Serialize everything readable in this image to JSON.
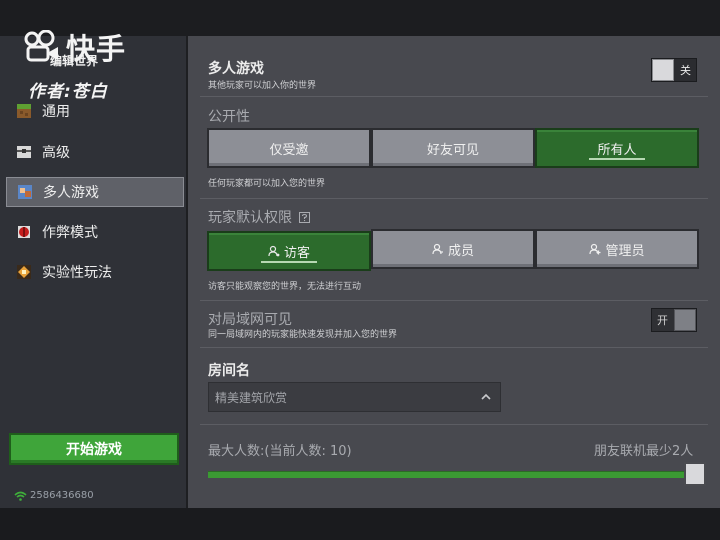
{
  "watermark": {
    "brand": "快手",
    "author": "作者:苍白"
  },
  "sidebar": {
    "title": "编辑世界",
    "items": [
      {
        "label": "通用",
        "icon": "grass-block-icon"
      },
      {
        "label": "高级",
        "icon": "chest-icon"
      },
      {
        "label": "多人游戏",
        "icon": "players-icon",
        "active": true
      },
      {
        "label": "作弊模式",
        "icon": "redstone-icon"
      },
      {
        "label": "实验性玩法",
        "icon": "experiment-icon"
      }
    ],
    "start_button": "开始游戏",
    "server_id": "2586436680"
  },
  "multiplayer": {
    "title": "多人游戏",
    "subtitle": "其他玩家可以加入你的世界",
    "toggle_label": "关",
    "toggle_on": false
  },
  "visibility": {
    "title": "公开性",
    "options": [
      "仅受邀",
      "好友可见",
      "所有人"
    ],
    "selected": "所有人",
    "hint": "任何玩家都可以加入您的世界"
  },
  "permission": {
    "title": "玩家默认权限",
    "options": [
      "访客",
      "成员",
      "管理员"
    ],
    "selected": "访客",
    "hint": "访客只能观察您的世界，无法进行互动"
  },
  "lan": {
    "title": "对局域网可见",
    "subtitle": "同一局域网内的玩家能快速发现并加入您的世界",
    "toggle_label": "开",
    "toggle_on": true
  },
  "room": {
    "title": "房间名",
    "value": "精美建筑欣赏"
  },
  "max_players": {
    "label": "最大人数:(当前人数: 10)",
    "right_note": "朋友联机最少2人",
    "fill_fraction": 1.0
  },
  "colors": {
    "accent_green": "#3fa53a",
    "selected_green": "#2c6b2c",
    "panel": "#48494f",
    "sidebar": "#2f3137"
  }
}
